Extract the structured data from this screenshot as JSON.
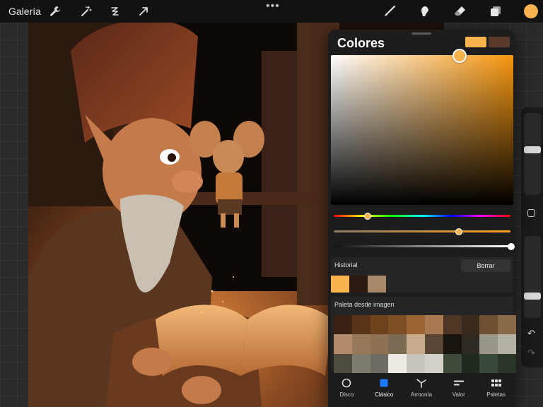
{
  "toolbar": {
    "gallery_label": "Galería",
    "left_tools": [
      "wrench-icon",
      "magic-wand-icon",
      "selection-icon",
      "transform-arrow-icon"
    ],
    "right_tools": [
      "brush-icon",
      "smudge-icon",
      "eraser-icon",
      "layers-icon"
    ],
    "current_color": "#f7b34e"
  },
  "color_panel": {
    "title": "Colores",
    "primary_color": "#f7b34e",
    "secondary_color": "#5b3a2c",
    "hue_position": 0.19,
    "saturation_position": 0.7,
    "opacity_position": 1.0,
    "history": {
      "label": "Historial",
      "clear_label": "Borrar",
      "swatches": [
        "#f7b34e",
        "#2a1a12",
        "#a8876a"
      ]
    },
    "palette": {
      "label": "Paleta desde imagen",
      "colors": [
        "#3a2212",
        "#5a3416",
        "#6e421c",
        "#7e4e24",
        "#9a6332",
        "#a87a52",
        "#4e3524",
        "#3a2a1c",
        "#6e5030",
        "#8a6a48",
        "#b28c6c",
        "#98785a",
        "#8e7052",
        "#7a6a54",
        "#c4ac8c",
        "#5a4634",
        "#1a140e",
        "#2e2a22",
        "#9a968a",
        "#b4b2a6",
        "#4e4a40",
        "#7e7a6e",
        "#6e6c62",
        "#eceae2",
        "#c8c6bc",
        "#d4d2c8",
        "#3e4a3a",
        "#1e2a1e",
        "#3a4a3a",
        "#2a3628"
      ]
    },
    "tabs": [
      {
        "label": "Disco",
        "icon": "disc-icon"
      },
      {
        "label": "Clásico",
        "icon": "classic-square-icon",
        "active": true
      },
      {
        "label": "Armonía",
        "icon": "harmony-icon"
      },
      {
        "label": "Valor",
        "icon": "value-sliders-icon"
      },
      {
        "label": "Paletas",
        "icon": "palettes-grid-icon"
      }
    ]
  }
}
